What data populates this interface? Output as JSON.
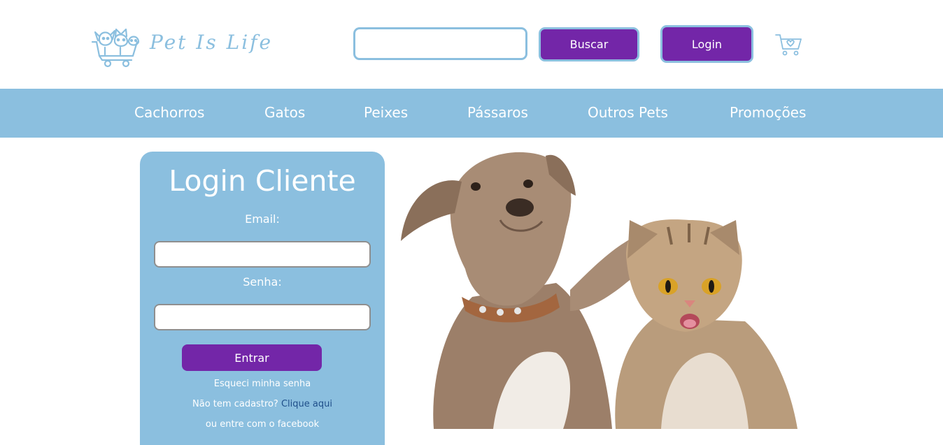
{
  "brand": {
    "name": "Pet Is Life",
    "accent_color": "#8bbfdf",
    "primary_color": "#7326a8",
    "logo_icon": "pets-cart-logo-icon"
  },
  "header": {
    "search_value": "",
    "search_button": "Buscar",
    "login_button": "Login",
    "cart_icon": "shopping-cart-heart-icon"
  },
  "nav": {
    "items": [
      {
        "label": "Cachorros"
      },
      {
        "label": "Gatos"
      },
      {
        "label": "Peixes"
      },
      {
        "label": "Pássaros"
      },
      {
        "label": "Outros Pets"
      },
      {
        "label": "Promoções"
      }
    ]
  },
  "login": {
    "title": "Login Cliente",
    "email_label": "Email:",
    "email_value": "",
    "password_label": "Senha:",
    "password_value": "",
    "submit_button": "Entrar",
    "forgot_password": "Esqueci minha senha",
    "no_account_text": "Não tem cadastro?",
    "register_link": "Clique aqui",
    "facebook_text": "ou entre com o facebook"
  },
  "hero": {
    "image_icon": "dog-and-cat-photo"
  }
}
